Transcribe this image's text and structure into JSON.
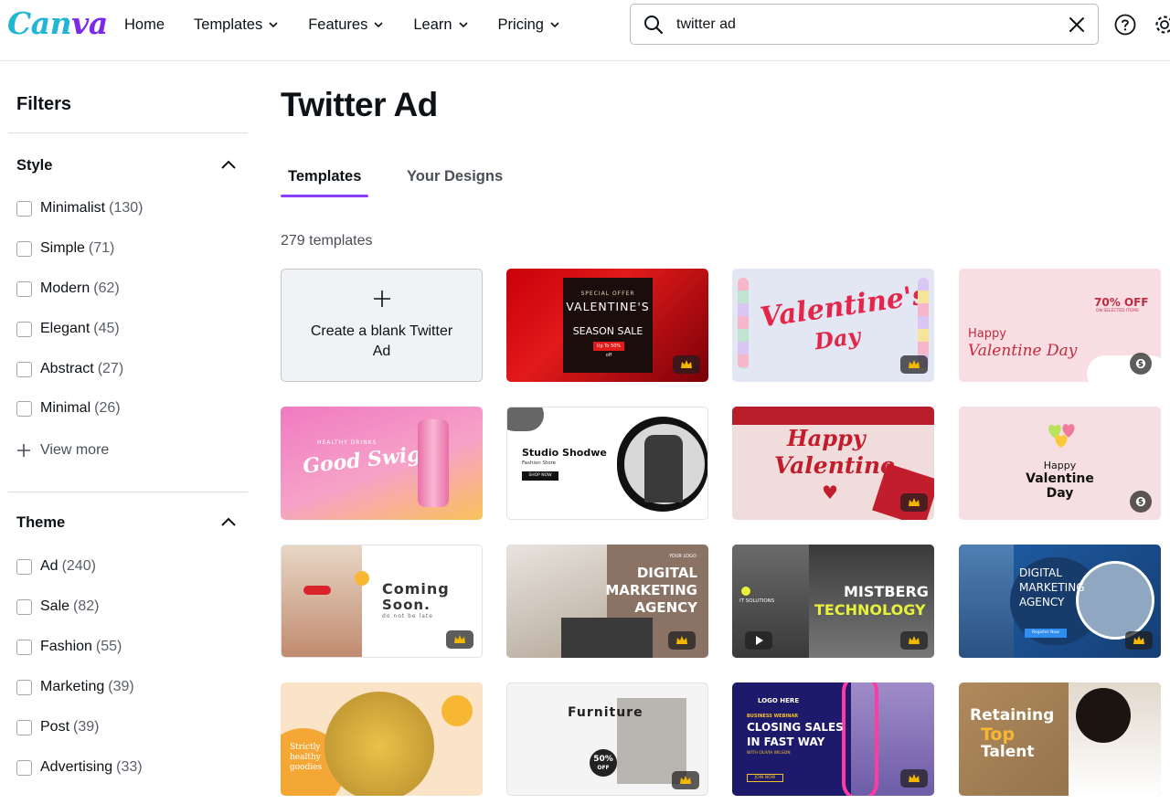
{
  "brand": {
    "logo_text_a": "Can",
    "logo_text_b": "va"
  },
  "nav": [
    {
      "label": "Home",
      "has_dropdown": false
    },
    {
      "label": "Templates",
      "has_dropdown": true
    },
    {
      "label": "Features",
      "has_dropdown": true
    },
    {
      "label": "Learn",
      "has_dropdown": true
    },
    {
      "label": "Pricing",
      "has_dropdown": true
    }
  ],
  "search": {
    "value": "twitter ad",
    "icon": "search-icon",
    "clear_icon": "close-icon"
  },
  "header_icons": [
    "help-icon",
    "gear-icon"
  ],
  "sidebar": {
    "title": "Filters",
    "style": {
      "title": "Style",
      "items": [
        {
          "label": "Minimalist",
          "count": "(130)"
        },
        {
          "label": "Simple",
          "count": "(71)"
        },
        {
          "label": "Modern",
          "count": "(62)"
        },
        {
          "label": "Elegant",
          "count": "(45)"
        },
        {
          "label": "Abstract",
          "count": "(27)"
        },
        {
          "label": "Minimal",
          "count": "(26)"
        }
      ],
      "view_more": "View more"
    },
    "theme": {
      "title": "Theme",
      "items": [
        {
          "label": "Ad",
          "count": "(240)"
        },
        {
          "label": "Sale",
          "count": "(82)"
        },
        {
          "label": "Fashion",
          "count": "(55)"
        },
        {
          "label": "Marketing",
          "count": "(39)"
        },
        {
          "label": "Post",
          "count": "(39)"
        },
        {
          "label": "Advertising",
          "count": "(33)"
        }
      ]
    }
  },
  "main": {
    "title": "Twitter Ad",
    "tabs": [
      {
        "label": "Templates",
        "active": true
      },
      {
        "label": "Your Designs",
        "active": false
      }
    ],
    "count_text": "279 templates",
    "blank_card_label": "Create a blank Twitter Ad",
    "templates": [
      {
        "text": [
          "SPECIAL OFFER",
          "VALENTINE'S",
          "SEASON SALE",
          "Up To 50% off"
        ],
        "badge": "crown"
      },
      {
        "text": [
          "Valentine's",
          "Day"
        ],
        "badge": "crown"
      },
      {
        "text": [
          "70% OFF",
          "ON SELECTED ITEMS",
          "Happy",
          "Valentine Day"
        ],
        "badge": "dollar"
      },
      {
        "text": [
          "HEALTHY DRINKS",
          "Good Swig"
        ],
        "badge": "none"
      },
      {
        "text": [
          "Studio Shodwe",
          "Fashion Store",
          "SHOP NOW"
        ],
        "badge": "none"
      },
      {
        "text": [
          "Happy",
          "Valentine"
        ],
        "badge": "crown"
      },
      {
        "text": [
          "Happy",
          "Valentine",
          "Day"
        ],
        "badge": "dollar"
      },
      {
        "text": [
          "Coming",
          "Soon.",
          "do not be late"
        ],
        "badge": "crown"
      },
      {
        "text": [
          "YOUR LOGO",
          "DIGITAL",
          "MARKETING",
          "AGENCY"
        ],
        "badge": "crown"
      },
      {
        "text": [
          "IT SOLUTIONS",
          "MISTBERG",
          "TECHNOLOGY"
        ],
        "badge": "crown"
      },
      {
        "text": [
          "DIGITAL",
          "MARKETING",
          "AGENCY",
          "Register Now"
        ],
        "badge": "crown"
      },
      {
        "text": [
          "Strictly",
          "healthy",
          "goodies"
        ],
        "badge": "none"
      },
      {
        "text": [
          "Furniture",
          "50%",
          "OFF"
        ],
        "badge": "crown"
      },
      {
        "text": [
          "LOGO HERE",
          "BUSINESS WEBINAR",
          "CLOSING SALES",
          "IN FAST WAY",
          "WITH OLIVIA WILSON",
          "JOIN NOW"
        ],
        "badge": "crown"
      },
      {
        "text": [
          "Retaining",
          "Top",
          "Talent"
        ],
        "badge": "none"
      }
    ]
  }
}
